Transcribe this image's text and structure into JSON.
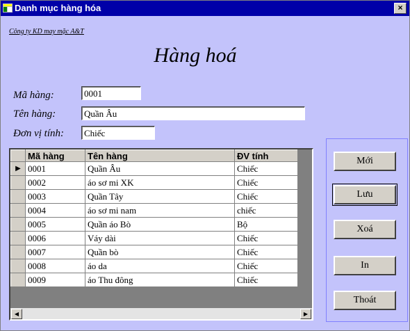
{
  "window": {
    "title": "Danh mục hàng hóa",
    "close_glyph": "×"
  },
  "company": "Công ty KD may mặc A&T",
  "headline": "Hàng hoá",
  "form": {
    "ma_hang_label": "Mã hàng:",
    "ma_hang_value": "0001",
    "ten_hang_label": "Tên hàng:",
    "ten_hang_value": "Quần Âu",
    "dvt_label": "Đơn vị tính:",
    "dvt_value": "Chiếc"
  },
  "grid": {
    "columns": [
      "Mã hàng",
      "Tên hàng",
      "ĐV tính"
    ],
    "rows": [
      [
        "0001",
        "Quần Âu",
        "Chiếc"
      ],
      [
        "0002",
        "áo sơ mi XK",
        "Chiếc"
      ],
      [
        "0003",
        "Quần Tây",
        "Chiếc"
      ],
      [
        "0004",
        "áo sơ mi nam",
        "chiếc"
      ],
      [
        "0005",
        "Quần áo Bò",
        "Bộ"
      ],
      [
        "0006",
        "Váy dài",
        "Chiếc"
      ],
      [
        "0007",
        "Quần bò",
        "Chiếc"
      ],
      [
        "0008",
        "áo da",
        "Chiếc"
      ],
      [
        "0009",
        "áo Thu đông",
        "Chiếc"
      ]
    ],
    "current_row_marker": "▶"
  },
  "buttons": {
    "moi": "Mới",
    "luu": "Lưu",
    "xoa": "Xoá",
    "in": "In",
    "thoat": "Thoát"
  },
  "icons": {
    "app": "grid-form-icon",
    "scroll_left": "left-arrow-icon",
    "scroll_right": "right-arrow-icon"
  }
}
